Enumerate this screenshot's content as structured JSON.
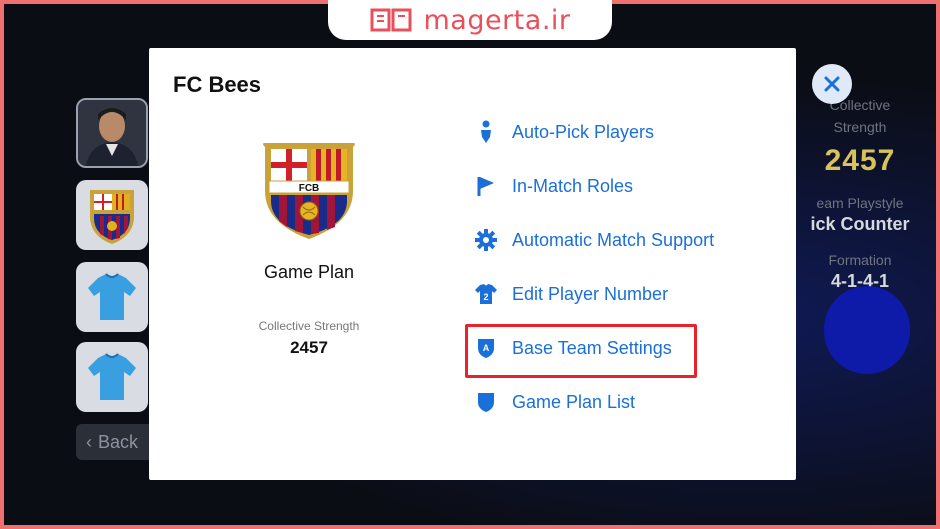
{
  "watermark": {
    "text": "magerta.ir",
    "icon": "book-logo-icon",
    "color": "#e8505b"
  },
  "background": {
    "back_label": "Back",
    "stats": {
      "collective_strength_label": "Collective Strength",
      "collective_strength_value": "2457",
      "team_playstyle_label": "eam Playstyle",
      "team_playstyle_value": "ick Counter",
      "formation_label": "Formation",
      "formation_value": "4-1-4-1"
    }
  },
  "modal": {
    "title": "FC Bees",
    "crest_text": "FCB",
    "game_plan_label": "Game Plan",
    "collective_strength_label": "Collective Strength",
    "collective_strength_value": "2457",
    "menu": [
      {
        "label": "Auto-Pick Players",
        "icon": "person-pin-icon"
      },
      {
        "label": "In-Match Roles",
        "icon": "flag-icon"
      },
      {
        "label": "Automatic Match Support",
        "icon": "gear-icon"
      },
      {
        "label": "Edit Player Number",
        "icon": "jersey-number-icon",
        "number": "2"
      },
      {
        "label": "Base Team Settings",
        "icon": "shield-a-icon",
        "letter": "A",
        "highlighted": true
      },
      {
        "label": "Game Plan List",
        "icon": "shield-icon"
      }
    ]
  },
  "colors": {
    "accent": "#1a6fd8",
    "highlight": "#e8242a",
    "frame": "#f07070"
  }
}
